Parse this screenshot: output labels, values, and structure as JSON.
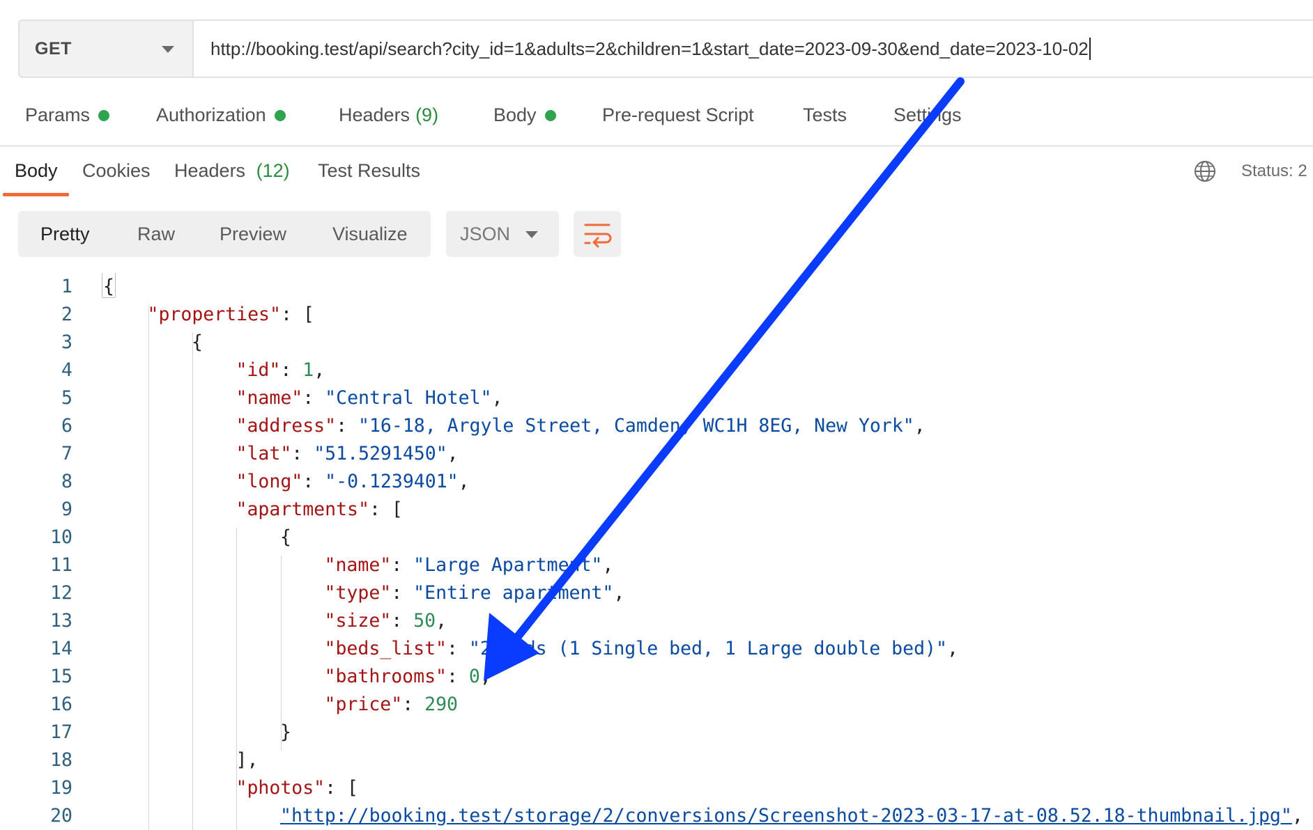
{
  "request": {
    "method": "GET",
    "url": "http://booking.test/api/search?city_id=1&adults=2&children=1&start_date=2023-09-30&end_date=2023-10-02"
  },
  "request_tabs": [
    {
      "label": "Params",
      "dot": true
    },
    {
      "label": "Authorization",
      "dot": true
    },
    {
      "label": "Headers",
      "count": "(9)"
    },
    {
      "label": "Body",
      "dot": true
    },
    {
      "label": "Pre-request Script"
    },
    {
      "label": "Tests"
    },
    {
      "label": "Settings"
    }
  ],
  "response_tabs": [
    {
      "label": "Body",
      "active": true
    },
    {
      "label": "Cookies"
    },
    {
      "label": "Headers",
      "count": "(12)"
    },
    {
      "label": "Test Results"
    }
  ],
  "status_text": "Status: 2",
  "format_tabs": [
    "Pretty",
    "Raw",
    "Preview",
    "Visualize"
  ],
  "format_active": "Pretty",
  "language": "JSON",
  "code_lines": [
    {
      "n": "1",
      "indent": 0,
      "parts": [
        [
          "p",
          "{"
        ]
      ]
    },
    {
      "n": "2",
      "indent": 1,
      "parts": [
        [
          "k",
          "\"properties\""
        ],
        [
          "p",
          ": ["
        ]
      ]
    },
    {
      "n": "3",
      "indent": 2,
      "parts": [
        [
          "p",
          "{"
        ]
      ]
    },
    {
      "n": "4",
      "indent": 3,
      "parts": [
        [
          "k",
          "\"id\""
        ],
        [
          "p",
          ": "
        ],
        [
          "n",
          "1"
        ],
        [
          "p",
          ","
        ]
      ]
    },
    {
      "n": "5",
      "indent": 3,
      "parts": [
        [
          "k",
          "\"name\""
        ],
        [
          "p",
          ": "
        ],
        [
          "s",
          "\"Central Hotel\""
        ],
        [
          "p",
          ","
        ]
      ]
    },
    {
      "n": "6",
      "indent": 3,
      "parts": [
        [
          "k",
          "\"address\""
        ],
        [
          "p",
          ": "
        ],
        [
          "s",
          "\"16-18, Argyle Street, Camden, WC1H 8EG, New York\""
        ],
        [
          "p",
          ","
        ]
      ]
    },
    {
      "n": "7",
      "indent": 3,
      "parts": [
        [
          "k",
          "\"lat\""
        ],
        [
          "p",
          ": "
        ],
        [
          "s",
          "\"51.5291450\""
        ],
        [
          "p",
          ","
        ]
      ]
    },
    {
      "n": "8",
      "indent": 3,
      "parts": [
        [
          "k",
          "\"long\""
        ],
        [
          "p",
          ": "
        ],
        [
          "s",
          "\"-0.1239401\""
        ],
        [
          "p",
          ","
        ]
      ]
    },
    {
      "n": "9",
      "indent": 3,
      "parts": [
        [
          "k",
          "\"apartments\""
        ],
        [
          "p",
          ": ["
        ]
      ]
    },
    {
      "n": "10",
      "indent": 4,
      "parts": [
        [
          "p",
          "{"
        ]
      ]
    },
    {
      "n": "11",
      "indent": 5,
      "parts": [
        [
          "k",
          "\"name\""
        ],
        [
          "p",
          ": "
        ],
        [
          "s",
          "\"Large Apartment\""
        ],
        [
          "p",
          ","
        ]
      ]
    },
    {
      "n": "12",
      "indent": 5,
      "parts": [
        [
          "k",
          "\"type\""
        ],
        [
          "p",
          ": "
        ],
        [
          "s",
          "\"Entire apartment\""
        ],
        [
          "p",
          ","
        ]
      ]
    },
    {
      "n": "13",
      "indent": 5,
      "parts": [
        [
          "k",
          "\"size\""
        ],
        [
          "p",
          ": "
        ],
        [
          "n",
          "50"
        ],
        [
          "p",
          ","
        ]
      ]
    },
    {
      "n": "14",
      "indent": 5,
      "parts": [
        [
          "k",
          "\"beds_list\""
        ],
        [
          "p",
          ": "
        ],
        [
          "s",
          "\"2 beds (1 Single bed, 1 Large double bed)\""
        ],
        [
          "p",
          ","
        ]
      ]
    },
    {
      "n": "15",
      "indent": 5,
      "parts": [
        [
          "k",
          "\"bathrooms\""
        ],
        [
          "p",
          ": "
        ],
        [
          "n",
          "0"
        ],
        [
          "p",
          ","
        ]
      ]
    },
    {
      "n": "16",
      "indent": 5,
      "parts": [
        [
          "k",
          "\"price\""
        ],
        [
          "p",
          ": "
        ],
        [
          "n",
          "290"
        ]
      ]
    },
    {
      "n": "17",
      "indent": 4,
      "parts": [
        [
          "p",
          "}"
        ]
      ]
    },
    {
      "n": "18",
      "indent": 3,
      "parts": [
        [
          "p",
          "],"
        ]
      ]
    },
    {
      "n": "19",
      "indent": 3,
      "parts": [
        [
          "k",
          "\"photos\""
        ],
        [
          "p",
          ": ["
        ]
      ]
    },
    {
      "n": "20",
      "indent": 4,
      "parts": [
        [
          "u",
          "\"http://booking.test/storage/2/conversions/Screenshot-2023-03-17-at-08.52.18-thumbnail.jpg\""
        ],
        [
          "p",
          ","
        ]
      ]
    }
  ],
  "colors": {
    "accent": "#ef6a38",
    "status_dot": "#2ea44f",
    "annotation_arrow": "#0a3cff"
  }
}
